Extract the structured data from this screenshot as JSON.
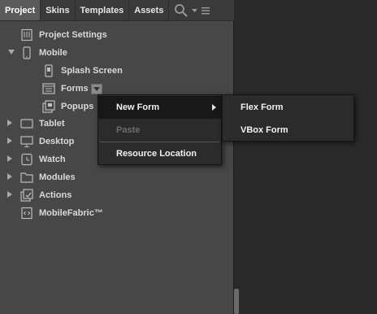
{
  "tabs": [
    {
      "label": "Project",
      "active": true
    },
    {
      "label": "Skins",
      "active": false
    },
    {
      "label": "Templates",
      "active": false
    },
    {
      "label": "Assets",
      "active": false
    }
  ],
  "tree": {
    "project_settings": "Project Settings",
    "mobile": "Mobile",
    "splash_screen": "Splash Screen",
    "forms": "Forms",
    "popups": "Popups",
    "tablet": "Tablet",
    "desktop": "Desktop",
    "watch": "Watch",
    "modules": "Modules",
    "actions": "Actions",
    "mobilefabric": "MobileFabric™"
  },
  "context_menu": {
    "new_form": "New Form",
    "paste": "Paste",
    "resource_location": "Resource Location"
  },
  "submenu": {
    "flex_form": "Flex Form",
    "vbox_form": "VBox Form"
  },
  "icons": [
    "search-icon",
    "dropdown-caret-icon",
    "panel-menu-icon"
  ],
  "colors": {
    "panel_bg": "#474747",
    "tab_active_bg": "#5a5a5a",
    "menu_bg": "#2b2b2b",
    "menu_active_bg": "#181818",
    "menu_disabled_text": "#6c6c6c",
    "workspace_bg": "#2a2a2a"
  }
}
